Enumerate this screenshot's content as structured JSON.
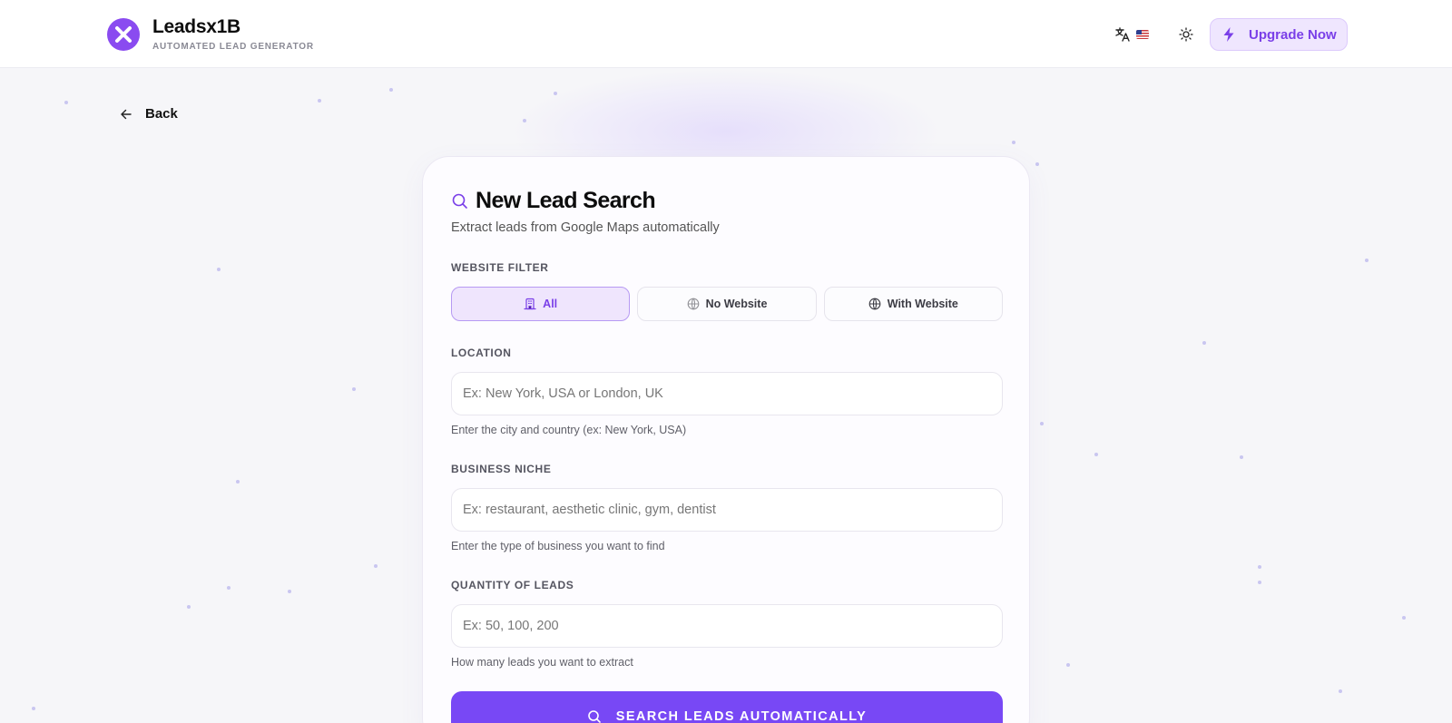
{
  "header": {
    "brand_name": "Leadsx1B",
    "brand_tagline": "AUTOMATED LEAD GENERATOR",
    "language_flag": "US",
    "upgrade_label": "Upgrade Now"
  },
  "nav": {
    "back_label": "Back"
  },
  "form": {
    "title": "New Lead Search",
    "subtitle": "Extract leads from Google Maps automatically",
    "website_filter": {
      "label": "WEBSITE FILTER",
      "options": [
        {
          "label": "All",
          "icon": "building-icon",
          "active": true
        },
        {
          "label": "No Website",
          "icon": "globe-icon",
          "active": false
        },
        {
          "label": "With Website",
          "icon": "globe-icon",
          "active": false
        }
      ]
    },
    "location": {
      "label": "LOCATION",
      "value": "",
      "placeholder": "Ex: New York, USA or London, UK",
      "helper": "Enter the city and country (ex: New York, USA)"
    },
    "niche": {
      "label": "BUSINESS NICHE",
      "value": "",
      "placeholder": "Ex: restaurant, aesthetic clinic, gym, dentist",
      "helper": "Enter the type of business you want to find"
    },
    "quantity": {
      "label": "QUANTITY OF LEADS",
      "value": "",
      "placeholder": "Ex: 50, 100, 200",
      "helper": "How many leads you want to extract"
    },
    "submit_label": "SEARCH LEADS AUTOMATICALLY"
  },
  "colors": {
    "accent": "#7848f5",
    "logo": "#8a4bf0",
    "active_filter_bg": "#efe5fd",
    "active_filter_text": "#7a3fe8"
  }
}
